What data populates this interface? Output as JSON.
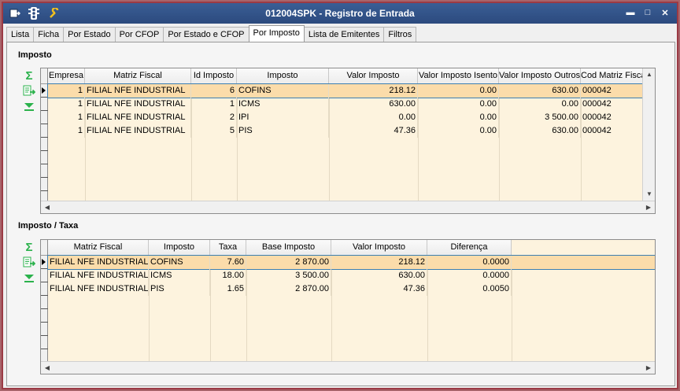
{
  "window": {
    "title": "012004SPK - Registro de Entrada",
    "minimize": "▬",
    "maximize": "□",
    "close": "✕"
  },
  "tabs": [
    "Lista",
    "Ficha",
    "Por Estado",
    "Por CFOP",
    "Por Estado e CFOP",
    "Por Imposto",
    "Lista de Emitentes",
    "Filtros"
  ],
  "active_tab": "Por Imposto",
  "imposto": {
    "label": "Imposto",
    "columns": [
      "Empresa",
      "Matriz Fiscal",
      "Id Imposto",
      "Imposto",
      "Valor Imposto",
      "Valor Imposto Isento",
      "Valor Imposto Outros",
      "Cod Matriz Fiscal"
    ],
    "rows": [
      [
        "1",
        "FILIAL NFE INDUSTRIAL",
        "6",
        "COFINS",
        "218.12",
        "0.00",
        "630.00",
        "000042"
      ],
      [
        "1",
        "FILIAL NFE INDUSTRIAL",
        "1",
        "ICMS",
        "630.00",
        "0.00",
        "0.00",
        "000042"
      ],
      [
        "1",
        "FILIAL NFE INDUSTRIAL",
        "2",
        "IPI",
        "0.00",
        "0.00",
        "3 500.00",
        "000042"
      ],
      [
        "1",
        "FILIAL NFE INDUSTRIAL",
        "5",
        "PIS",
        "47.36",
        "0.00",
        "630.00",
        "000042"
      ]
    ]
  },
  "imposto_taxa": {
    "label": "Imposto / Taxa",
    "columns": [
      "Matriz Fiscal",
      "Imposto",
      "Taxa",
      "Base Imposto",
      "Valor Imposto",
      "Diferença"
    ],
    "rows": [
      [
        "FILIAL NFE INDUSTRIAL",
        "COFINS",
        "7.60",
        "2 870.00",
        "218.12",
        "0.0000"
      ],
      [
        "FILIAL NFE INDUSTRIAL",
        "ICMS",
        "18.00",
        "3 500.00",
        "630.00",
        "0.0000"
      ],
      [
        "FILIAL NFE INDUSTRIAL",
        "PIS",
        "1.65",
        "2 870.00",
        "47.36",
        "0.0050"
      ]
    ]
  },
  "icons": {
    "sum": "Σ",
    "export": "export-icon",
    "expand": "expand-down-icon"
  },
  "colors": {
    "title_bar": "#2c4a7e",
    "grid_bg": "#fdf3de",
    "selected_row": "#fbdcaa",
    "outer_border": "#9b3a44"
  }
}
